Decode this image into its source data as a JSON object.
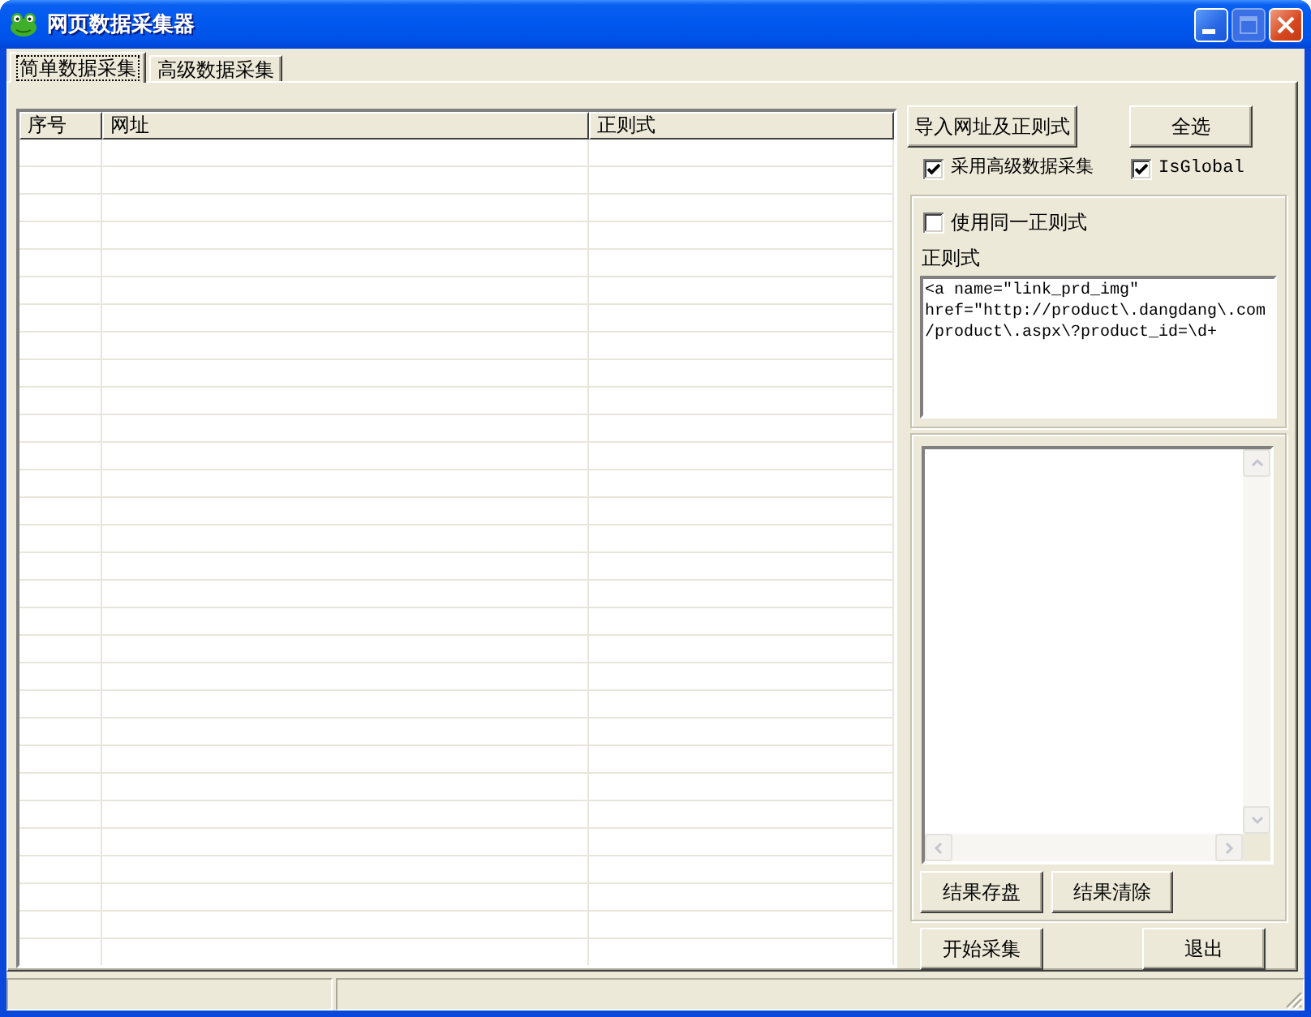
{
  "window": {
    "title": "网页数据采集器"
  },
  "title_buttons": [
    {
      "kind": "minimize",
      "disabled": false
    },
    {
      "kind": "maximize",
      "disabled": true
    },
    {
      "kind": "close",
      "disabled": false
    }
  ],
  "tabs": [
    {
      "label": "简单数据采集",
      "selected": true
    },
    {
      "label": "高级数据采集",
      "selected": false
    }
  ],
  "table": {
    "columns": [
      "序号",
      "网址",
      "正则式"
    ]
  },
  "actions": [
    "导入网址及正则式",
    "全选"
  ],
  "options": [
    {
      "label": "采用高级数据采集",
      "checked": true
    },
    {
      "label": "IsGlobal",
      "checked": true
    }
  ],
  "regex_group": {
    "same_regex": {
      "label": "使用同一正则式",
      "checked": false
    },
    "label": "正则式",
    "value": "<a name=\"link_prd_img\" href=\"http://product\\.dangdang\\.com/product\\.aspx\\?product_id=\\d+"
  },
  "result_group": {
    "buttons": [
      "结果存盘",
      "结果清除"
    ]
  },
  "bottom_buttons": [
    "开始采集",
    "退出"
  ]
}
